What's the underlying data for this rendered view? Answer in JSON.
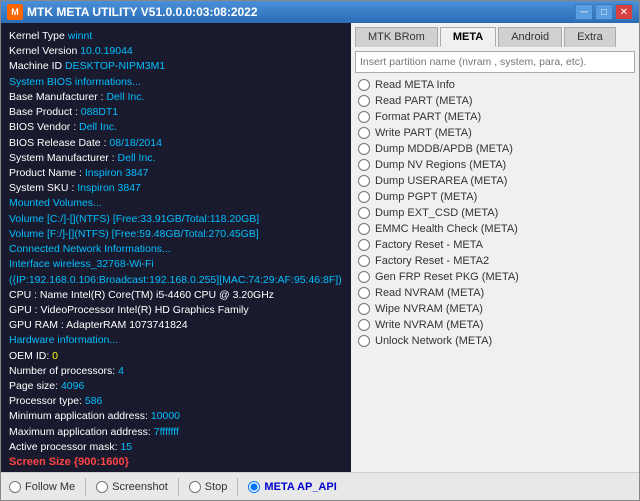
{
  "window": {
    "title": "MTK META UTILITY V51.0.0.0:03:08:2022",
    "icon": "M"
  },
  "title_buttons": {
    "minimize": "─",
    "maximize": "□",
    "close": "✕"
  },
  "left_panel": {
    "lines": [
      {
        "label": "Kernel Type ",
        "value": "winnt",
        "label_color": "white",
        "value_color": "cyan"
      },
      {
        "label": "Kernel Version ",
        "value": "10.0.19044",
        "label_color": "white",
        "value_color": "cyan"
      },
      {
        "label": "Machine ID ",
        "value": "DESKTOP-NIPM3M1",
        "label_color": "white",
        "value_color": "cyan"
      },
      {
        "label": "System BIOS informations...",
        "value": "",
        "label_color": "cyan",
        "value_color": "cyan"
      },
      {
        "label": "Base Manufacturer : ",
        "value": "Dell Inc.",
        "label_color": "white",
        "value_color": "cyan"
      },
      {
        "label": "Base Product : ",
        "value": "088DT1",
        "label_color": "white",
        "value_color": "cyan"
      },
      {
        "label": "BIOS Vendor : ",
        "value": "Dell Inc.",
        "label_color": "white",
        "value_color": "cyan"
      },
      {
        "label": "BIOS Release Date : ",
        "value": "08/18/2014",
        "label_color": "white",
        "value_color": "cyan"
      },
      {
        "label": "System Manufacturer : ",
        "value": "Dell Inc.",
        "label_color": "white",
        "value_color": "cyan"
      },
      {
        "label": "Product Name : ",
        "value": "Inspiron 3847",
        "label_color": "white",
        "value_color": "cyan"
      },
      {
        "label": "System SKU : ",
        "value": "Inspiron 3847",
        "label_color": "white",
        "value_color": "cyan"
      },
      {
        "label": "Mounted Volumes...",
        "value": "",
        "label_color": "cyan",
        "value_color": "cyan"
      },
      {
        "label": "Volume [C:/]-[](NTFS) [Free:33.91GB/Total:118.20GB]",
        "value": "",
        "label_color": "cyan",
        "value_color": "cyan"
      },
      {
        "label": "Volume [F:/]-[](NTFS) [Free:59.48GB/Total:270.45GB]",
        "value": "",
        "label_color": "cyan",
        "value_color": "cyan"
      },
      {
        "label": "Connected Network Informations...",
        "value": "",
        "label_color": "cyan",
        "value_color": "cyan"
      },
      {
        "label": "Interface wireless_32768-Wi-Fi ({IP:192.168.0.106:Broadcast:192.168.0.255][MAC:74:29:AF:95:46:8F])",
        "value": "",
        "label_color": "cyan",
        "value_color": "cyan"
      },
      {
        "label": "CPU  : Name Intel(R) Core(TM) i5-4460 CPU @ 3.20GHz",
        "value": "",
        "label_color": "white",
        "value_color": "white"
      },
      {
        "label": "GPU  : VideoProcessor Intel(R) HD Graphics Family",
        "value": "",
        "label_color": "white",
        "value_color": "white"
      },
      {
        "label": "GPU RAM  : AdapterRAM 1073741824",
        "value": "",
        "label_color": "white",
        "value_color": "white"
      },
      {
        "label": "Hardware information...",
        "value": "",
        "label_color": "cyan",
        "value_color": "cyan"
      },
      {
        "label": "OEM ID: ",
        "value": "0",
        "label_color": "white",
        "value_color": "yellow"
      },
      {
        "label": "Number of processors: ",
        "value": "4",
        "label_color": "white",
        "value_color": "cyan"
      },
      {
        "label": "Page size: ",
        "value": "4096",
        "label_color": "white",
        "value_color": "cyan"
      },
      {
        "label": "Processor type: ",
        "value": "586",
        "label_color": "white",
        "value_color": "cyan"
      },
      {
        "label": "Minimum application address: ",
        "value": "10000",
        "label_color": "white",
        "value_color": "cyan"
      },
      {
        "label": "Maximum application address: ",
        "value": "7fffffff",
        "label_color": "white",
        "value_color": "cyan"
      },
      {
        "label": "Active processor mask: ",
        "value": "15",
        "label_color": "white",
        "value_color": "cyan"
      },
      {
        "label": "Screen Size {900:1600}",
        "value": "",
        "label_color": "screen_size",
        "value_color": "cyan"
      }
    ]
  },
  "tabs": [
    {
      "id": "mtk-brom",
      "label": "MTK BRom",
      "active": false
    },
    {
      "id": "meta",
      "label": "META",
      "active": true
    },
    {
      "id": "android",
      "label": "Android",
      "active": false
    },
    {
      "id": "extra",
      "label": "Extra",
      "active": false
    }
  ],
  "partition_input": {
    "placeholder": "Insert partition name (nvram , system, para, etc)."
  },
  "radio_options": [
    {
      "id": "read-meta-info",
      "label": "Read META Info",
      "checked": false
    },
    {
      "id": "read-part-meta",
      "label": "Read PART (META)",
      "checked": false
    },
    {
      "id": "format-part-meta",
      "label": "Format PART (META)",
      "checked": false
    },
    {
      "id": "write-part-meta",
      "label": "Write PART (META)",
      "checked": false
    },
    {
      "id": "dump-mddb-apdb-meta",
      "label": "Dump MDDB/APDB (META)",
      "checked": false
    },
    {
      "id": "dump-nv-regions-meta",
      "label": "Dump NV Regions (META)",
      "checked": false
    },
    {
      "id": "dump-userarea-meta",
      "label": "Dump USERAREA (META)",
      "checked": false
    },
    {
      "id": "dump-pgpt-meta",
      "label": "Dump PGPT (META)",
      "checked": false
    },
    {
      "id": "dump-ext-csd-meta",
      "label": "Dump  EXT_CSD (META)",
      "checked": false
    },
    {
      "id": "emmc-health-check-meta",
      "label": "EMMC Health Check (META)",
      "checked": false
    },
    {
      "id": "factory-reset-meta",
      "label": "Factory Reset - META",
      "checked": false
    },
    {
      "id": "factory-reset-meta2",
      "label": "Factory Reset - META2",
      "checked": false
    },
    {
      "id": "gen-frp-reset-pkg-meta",
      "label": "Gen FRP Reset PKG (META)",
      "checked": false
    },
    {
      "id": "read-nvram-meta",
      "label": "Read NVRAM (META)",
      "checked": false
    },
    {
      "id": "wipe-nvram-meta",
      "label": "Wipe NVRAM (META)",
      "checked": false
    },
    {
      "id": "write-nvram-meta",
      "label": "Write NVRAM (META)",
      "checked": false
    },
    {
      "id": "unlock-network-meta",
      "label": "Unlock Network (META)",
      "checked": false
    }
  ],
  "bottom_bar": {
    "follow_me_label": "Follow Me",
    "screenshot_label": "Screenshot",
    "stop_label": "Stop",
    "meta_ap_api_label": "META AP_API"
  }
}
